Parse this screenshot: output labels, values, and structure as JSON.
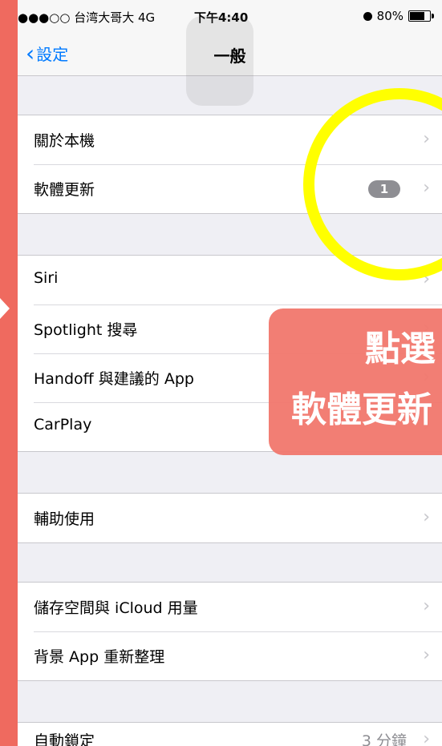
{
  "status_bar": {
    "carrier": "●●●○○ 台湾大哥大  4G",
    "time": "下午4:40",
    "battery": "80%",
    "icons": [
      "alarm-icon",
      "battery-icon"
    ]
  },
  "nav": {
    "back_label": "設定",
    "title": "一般"
  },
  "groups": [
    {
      "rows": [
        {
          "label": "關於本機"
        },
        {
          "label": "軟體更新",
          "badge": "1"
        }
      ]
    },
    {
      "rows": [
        {
          "label": "Siri"
        },
        {
          "label": "Spotlight 搜尋"
        },
        {
          "label": "Handoff 與建議的 App"
        },
        {
          "label": "CarPlay"
        }
      ]
    },
    {
      "rows": [
        {
          "label": "輔助使用"
        }
      ]
    },
    {
      "rows": [
        {
          "label": "儲存空間與 iCloud 用量"
        },
        {
          "label": "背景 App 重新整理"
        }
      ]
    },
    {
      "rows": [
        {
          "label": "自動鎖定",
          "value": "3 分鐘"
        }
      ]
    }
  ],
  "callout": {
    "line1": "點選",
    "line2": "軟體更新"
  },
  "colors": {
    "background": "#ef6a5f",
    "callout": "#f27a70",
    "ring": "#ffff00",
    "ios_blue": "#007aff",
    "badge": "#8e8e93"
  }
}
